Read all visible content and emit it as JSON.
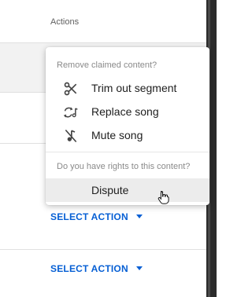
{
  "table": {
    "header": {
      "actions_label": "Actions"
    },
    "rows": [
      {
        "action_label": "SELECT ACTION"
      },
      {
        "action_label": "SELECT ACTION"
      }
    ]
  },
  "menu": {
    "section_remove_label": "Remove claimed content?",
    "items": [
      {
        "label": "Trim out segment",
        "icon": "scissors-icon"
      },
      {
        "label": "Replace song",
        "icon": "replace-music-icon"
      },
      {
        "label": "Mute song",
        "icon": "mute-music-icon"
      }
    ],
    "section_rights_label": "Do you have rights to this content?",
    "dispute_label": "Dispute"
  },
  "colors": {
    "accent": "#065fd4",
    "menu_hover": "#ececec",
    "row_highlight": "#f2f2f2"
  }
}
